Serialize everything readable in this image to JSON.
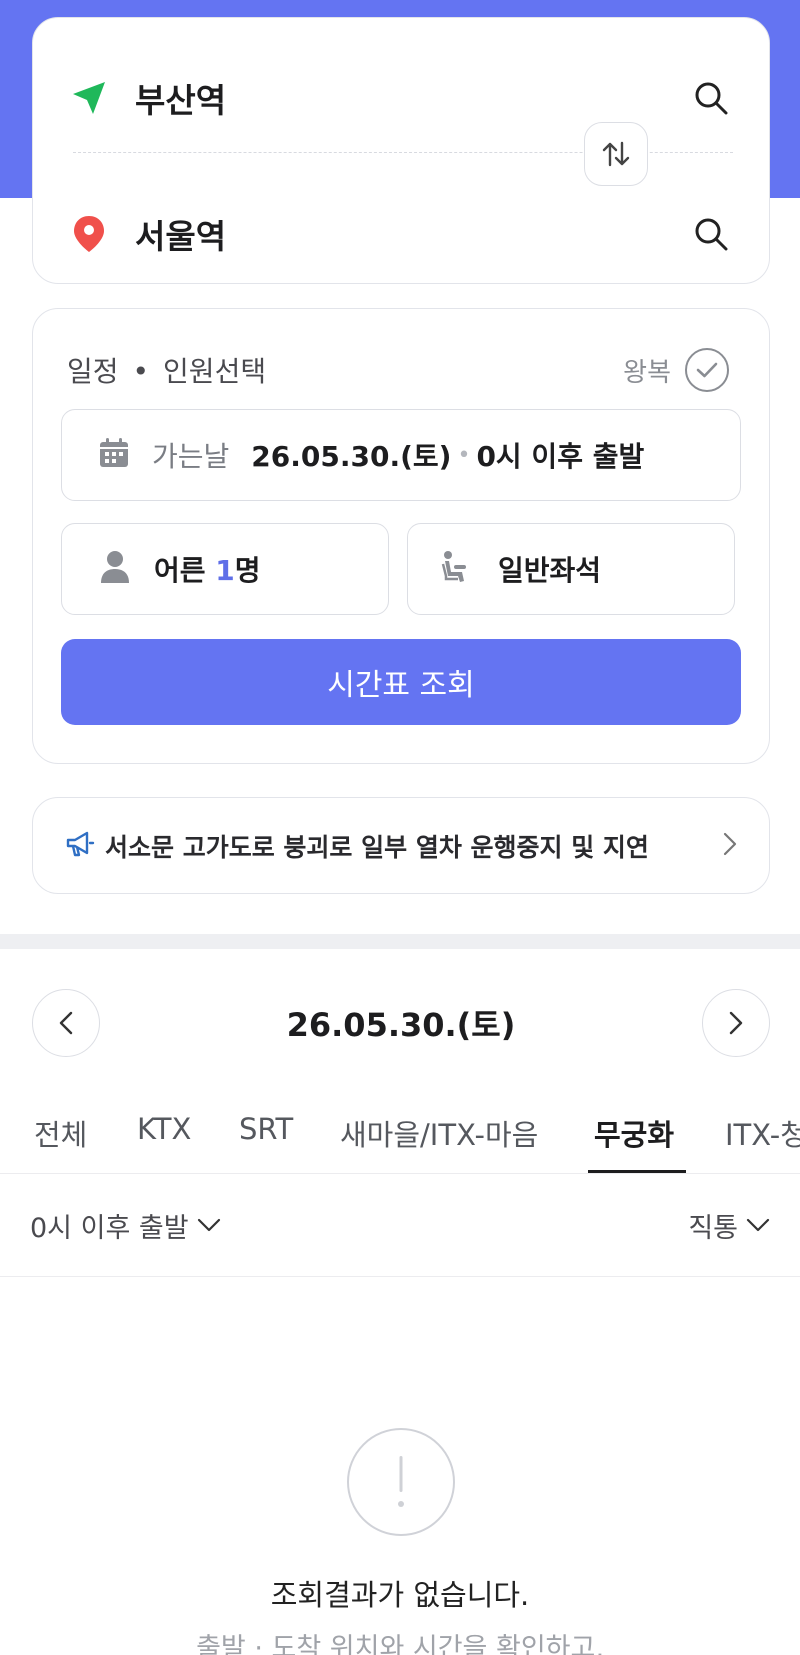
{
  "route": {
    "departure": "부산역",
    "arrival": "서울역"
  },
  "schedule": {
    "title": "일정",
    "dot": "•",
    "subtitle": "인원선택",
    "roundtrip_label": "왕복",
    "date_label": "가는날",
    "date_value": "26.05.30.(토)",
    "date_sep": "•",
    "time_value": "0시 이후 출발",
    "passenger_prefix": "어른 ",
    "passenger_count": "1",
    "passenger_unit": "명",
    "seat_type": "일반좌석",
    "search_button": "시간표 조회"
  },
  "notice": {
    "text": "서소문 고가도로 붕괴로 일부 열차 운행중지 및 지연"
  },
  "date_nav": {
    "date": "26.05.30.(토)"
  },
  "tabs": [
    {
      "label": "전체"
    },
    {
      "label": "KTX"
    },
    {
      "label": "SRT"
    },
    {
      "label": "새마을/ITX-마음"
    },
    {
      "label": "무궁화"
    },
    {
      "label": "ITX-청"
    }
  ],
  "active_tab": "무궁화",
  "filters": {
    "time": "0시 이후 출발",
    "direct": "직통"
  },
  "empty": {
    "title": "조회결과가 없습니다.",
    "subtitle": "출발 · 도착 위치와 시간을 확인하고,"
  },
  "colors": {
    "accent": "#6474f2",
    "departure_icon": "#1fb85a",
    "arrival_icon": "#f0504b",
    "notice_icon": "#2f6fc4"
  }
}
